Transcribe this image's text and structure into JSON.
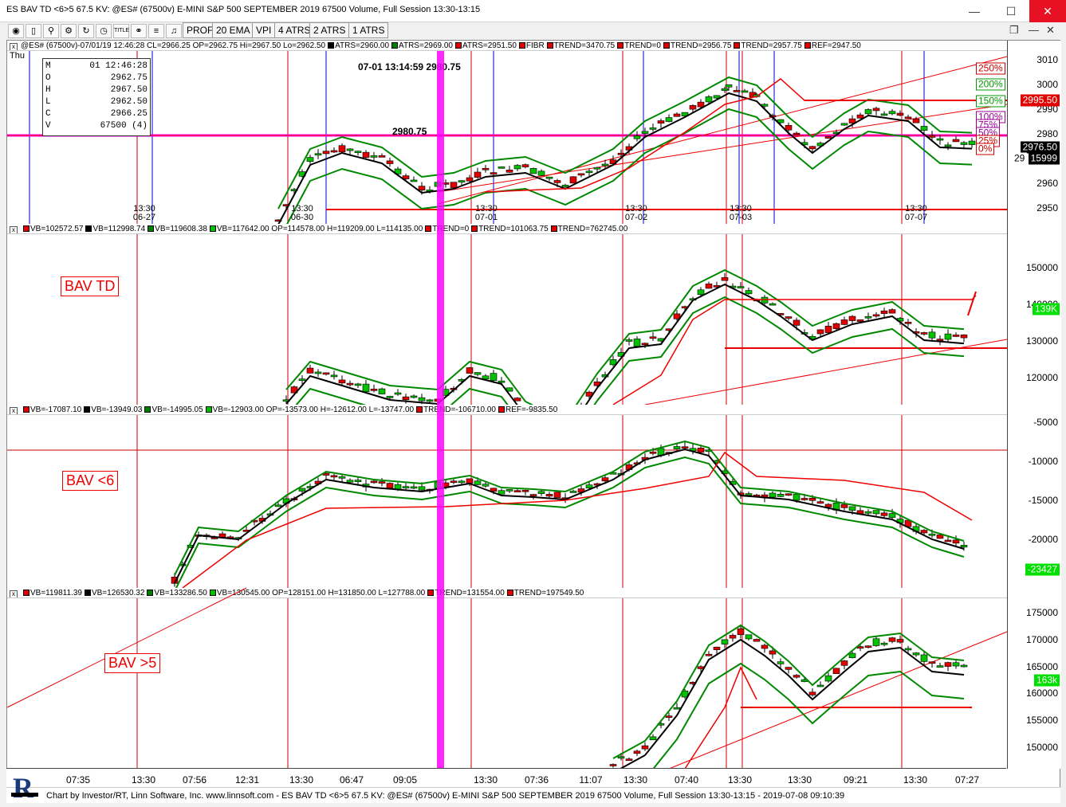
{
  "window": {
    "title": "ES BAV TD <6>5 67.5 KV: @ES# (67500v) E-MINI S&P 500 SEPTEMBER 2019 67500 Volume, Full Session 13:30-13:15",
    "min_icon": "minimize-icon",
    "max_icon": "maximize-icon",
    "close_icon": "close-icon"
  },
  "toolbar": {
    "buttons": [
      "PROF",
      "20 EMA",
      "VPI",
      "4 ATRS",
      "2 ATRS",
      "1 ATRS"
    ],
    "icon_title": "TITLE"
  },
  "pane1": {
    "day_label": "Thu",
    "legend": "@ES# (67500v)-07/01/19 12:46:28 CL=2966.25 OP=2962.75 Hi=2967.50 Lo=2962.50",
    "legend_items": [
      {
        "color": "#000000",
        "text": "ATRS=2960.00"
      },
      {
        "color": "#008000",
        "text": "ATRS=2969.00"
      },
      {
        "color": "#e00000",
        "text": "ATRS=2951.50"
      },
      {
        "color": "#e00000",
        "text": "FIBR"
      },
      {
        "color": "#e00000",
        "text": "TREND=3470.75"
      },
      {
        "color": "#e00000",
        "text": "TREND=0"
      },
      {
        "color": "#e00000",
        "text": "TREND=2956.75"
      },
      {
        "color": "#e00000",
        "text": "TREND=2957.75"
      },
      {
        "color": "#e00000",
        "text": "REF=2947.50"
      }
    ],
    "ohlc": [
      [
        "M",
        "01 12:46:28"
      ],
      [
        "O",
        "2962.75"
      ],
      [
        "H",
        "2967.50"
      ],
      [
        "L",
        "2962.50"
      ],
      [
        "C",
        "2966.25"
      ],
      [
        "V",
        "67500 (4)"
      ]
    ],
    "crosshair_text": "07-01 13:14:59 2980.75",
    "hline_text": "2980.75",
    "y_ticks": [
      "3010",
      "3000",
      "2990",
      "2980",
      "2970",
      "2960",
      "2950"
    ],
    "fib_labels": [
      [
        "250%",
        "#c00"
      ],
      [
        "200%",
        "#090"
      ],
      [
        "150%",
        "#090"
      ],
      [
        "100%",
        "#909"
      ],
      [
        "75%",
        "#909"
      ],
      [
        "50%",
        "#909"
      ],
      [
        "25%",
        "#c00"
      ],
      [
        "0%",
        "#c00"
      ]
    ],
    "price_badges": [
      {
        "text": "2995.50",
        "bg": "#e00000",
        "fg": "#fff"
      },
      {
        "text": "2976.50",
        "bg": "#000",
        "fg": "#fff"
      },
      {
        "text": "15999",
        "bg": "#000",
        "fg": "#fff"
      },
      {
        "text": "29",
        "bg": "#fff",
        "fg": "#000"
      }
    ],
    "date_labels": [
      [
        "13:30",
        "06-27"
      ],
      [
        "13:30",
        "06-30"
      ],
      [
        "13:30",
        "07-01"
      ],
      [
        "13:30",
        "07-02"
      ],
      [
        "13:30",
        "07-03"
      ],
      [
        "13:30",
        "07-07"
      ]
    ]
  },
  "pane2": {
    "legend_items": [
      {
        "color": "#e00000",
        "text": "VB=102572.57"
      },
      {
        "color": "#000000",
        "text": "VB=112998.74"
      },
      {
        "color": "#008000",
        "text": "VB=119608.38"
      },
      {
        "color": "#00c000",
        "text": "VB=117642.00 OP=114578.00 H=119209.00 L=114135.00"
      },
      {
        "color": "#e00000",
        "text": "TREND=0"
      },
      {
        "color": "#e00000",
        "text": "TREND=101063.75"
      },
      {
        "color": "#e00000",
        "text": "TREND=762745.00"
      }
    ],
    "label": "BAV TD",
    "y_ticks": [
      "150000",
      "140000",
      "130000",
      "120000"
    ],
    "badge": "139K"
  },
  "pane3": {
    "legend_items": [
      {
        "color": "#e00000",
        "text": "VB=-17087.10"
      },
      {
        "color": "#000000",
        "text": "VB=-13949.03"
      },
      {
        "color": "#008000",
        "text": "VB=-14995.05"
      },
      {
        "color": "#00c000",
        "text": "VB=-12903.00 OP=-13573.00 H=-12612.00 L=-13747.00"
      },
      {
        "color": "#e00000",
        "text": "TREND=-106710.00"
      },
      {
        "color": "#e00000",
        "text": "REF=-9835.50"
      }
    ],
    "label": "BAV <6",
    "y_ticks": [
      "-5000",
      "-10000",
      "-15000",
      "-20000"
    ],
    "badge": "-23427"
  },
  "pane4": {
    "legend_items": [
      {
        "color": "#e00000",
        "text": "VB=119811.39"
      },
      {
        "color": "#000000",
        "text": "VB=126530.32"
      },
      {
        "color": "#008000",
        "text": "VB=133286.50"
      },
      {
        "color": "#00c000",
        "text": "VB=130545.00 OP=128151.00 H=131850.00 L=127788.00"
      },
      {
        "color": "#e00000",
        "text": "TREND=131554.00"
      },
      {
        "color": "#e00000",
        "text": "TREND=197549.50"
      }
    ],
    "label": "BAV >5",
    "y_ticks": [
      "175000",
      "170000",
      "165000",
      "160000",
      "155000",
      "150000"
    ],
    "badge": "163k"
  },
  "time_axis": [
    "07:35",
    "13:30",
    "07:56",
    "12:31",
    "13:30",
    "06:47",
    "09:05",
    "13:30",
    "07:36",
    "11:07",
    "13:30",
    "07:40",
    "13:30",
    "13:30",
    "09:21",
    "13:30",
    "07:27"
  ],
  "status": "Chart by Investor/RT, Linn Software, Inc.  www.linnsoft.com - ES BAV TD <6>5 67.5 KV: @ES# (67500v) E-MINI S&P 500 SEPTEMBER 2019 67500 Volume, Full Session 13:30-13:15 - 2019-07-08 09:10:39",
  "colors": {
    "up": "#00c000",
    "down": "#e00000",
    "atr_mid": "#000000",
    "atr_up": "#008000",
    "trend": "#e00000",
    "session": "#0000cc",
    "magenta": "#ff00ff"
  }
}
